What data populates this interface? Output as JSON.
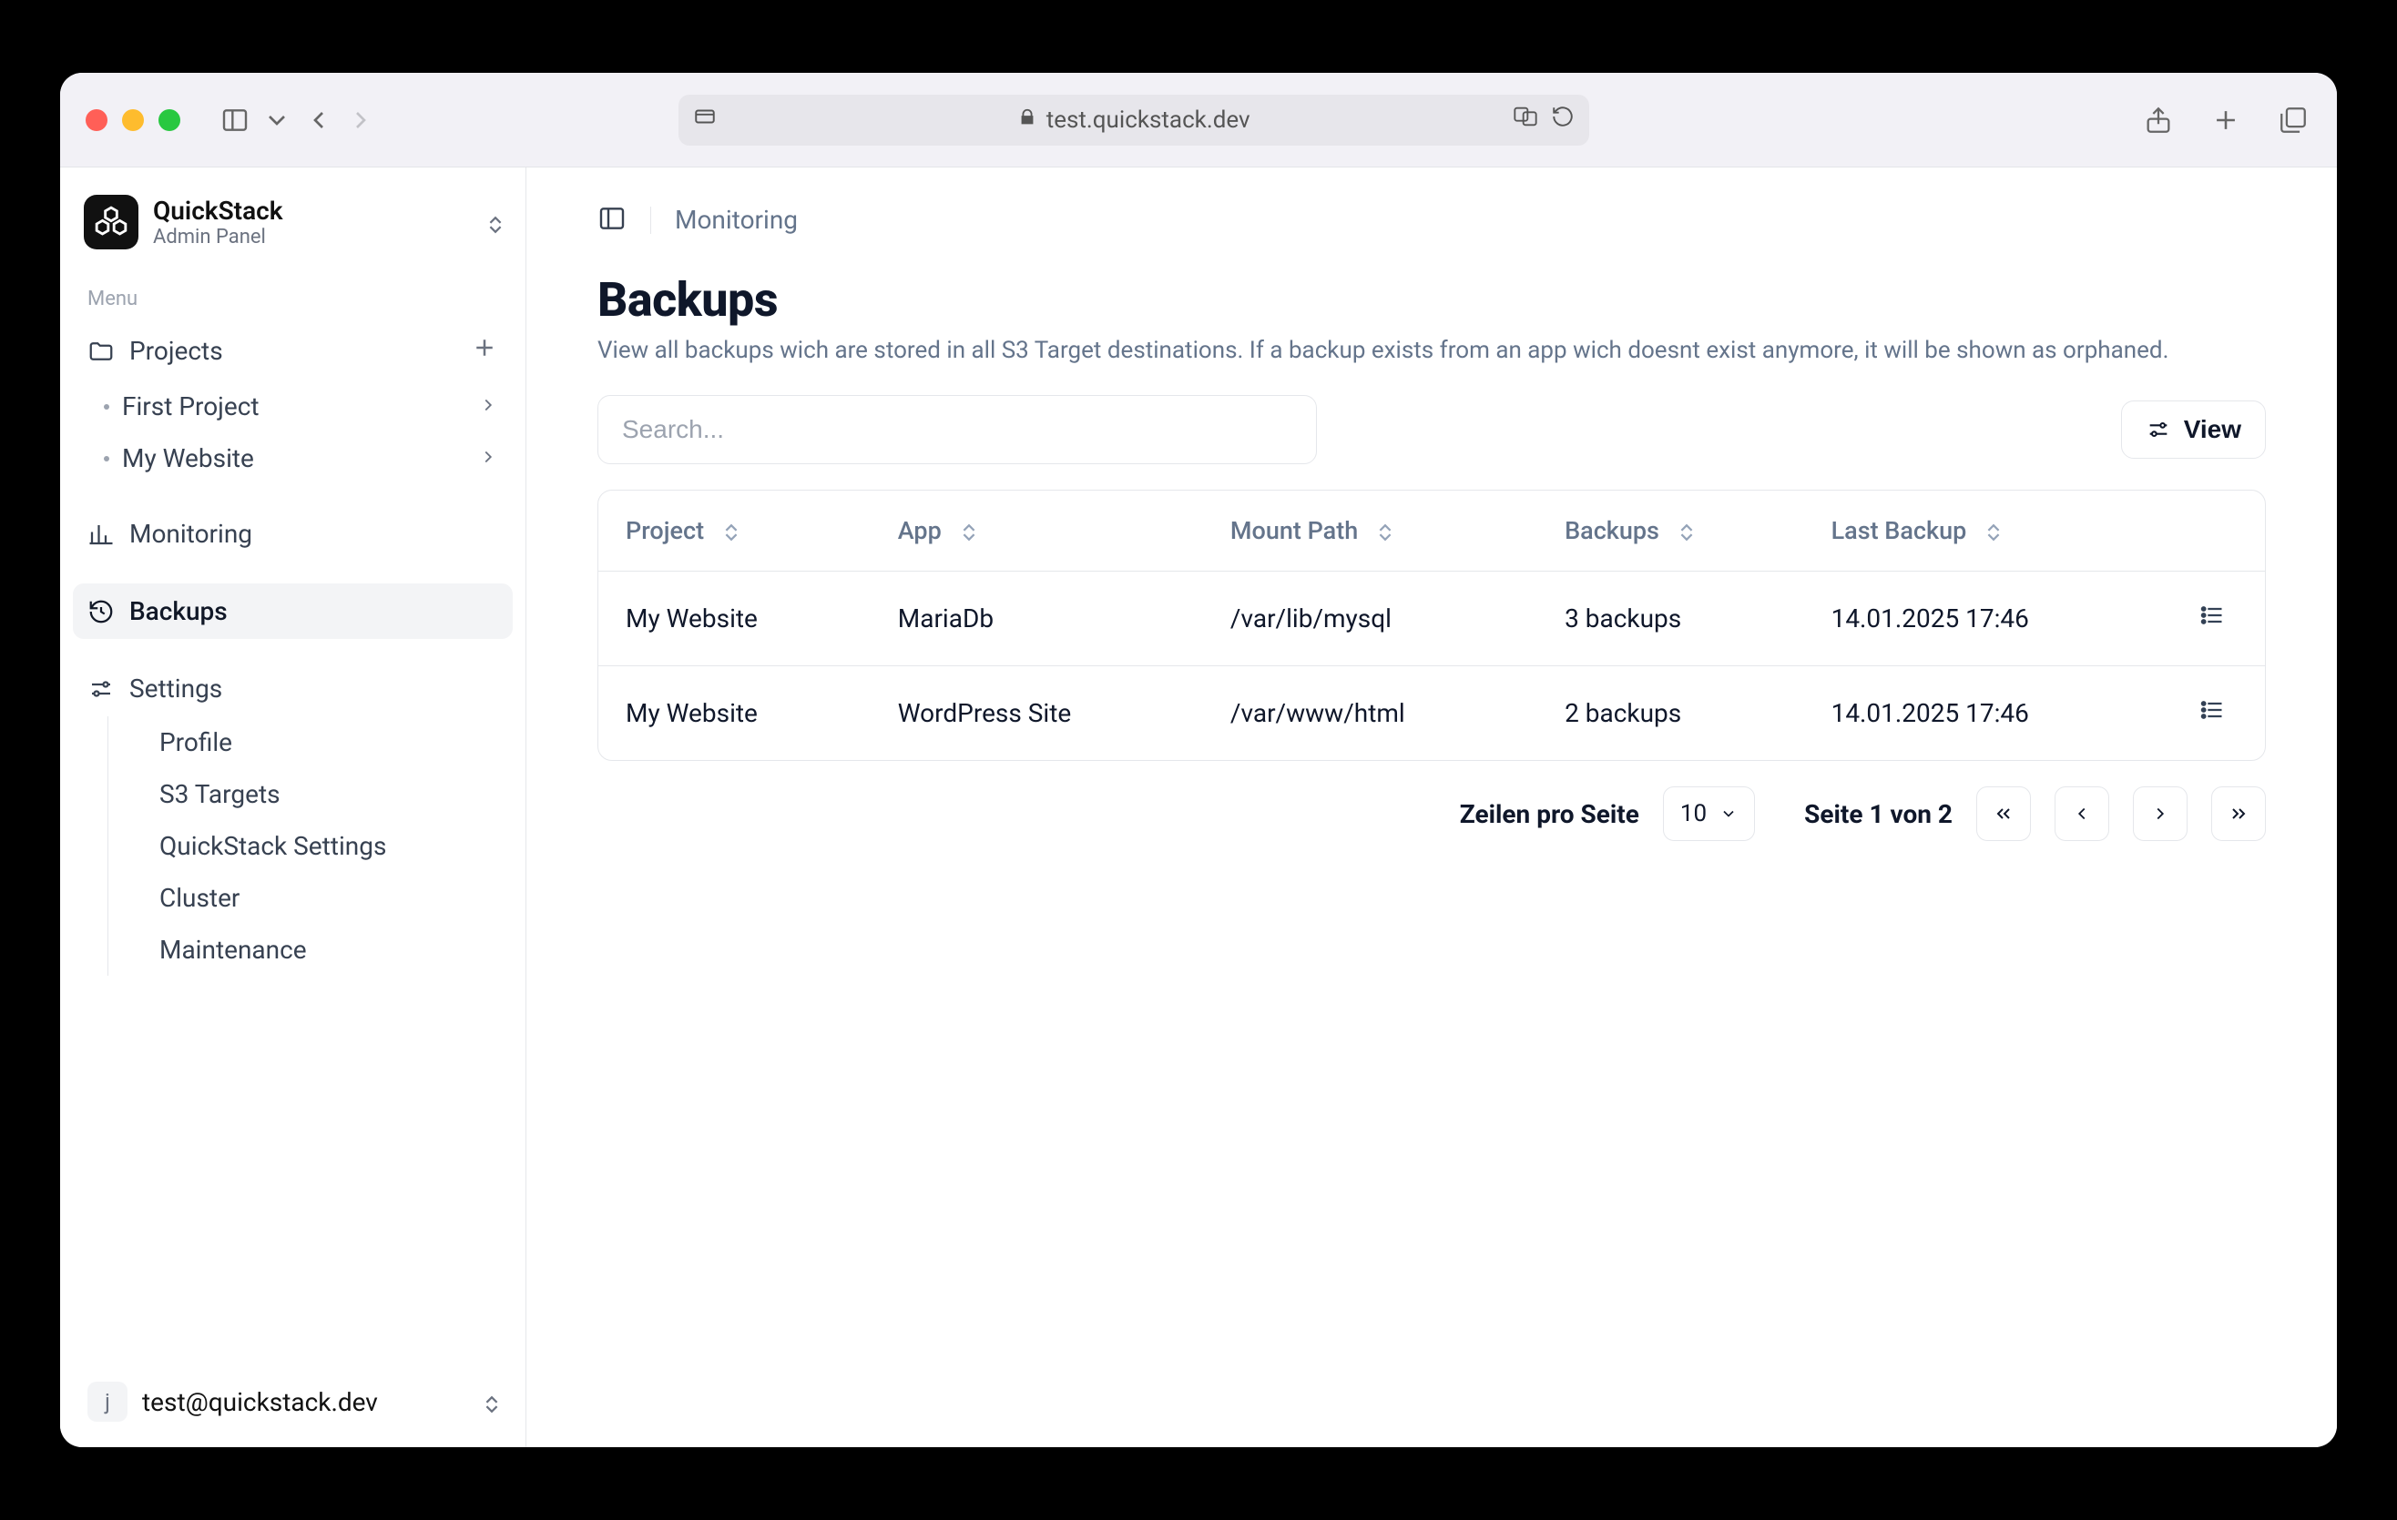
{
  "browser": {
    "address": "test.quickstack.dev"
  },
  "brand": {
    "name": "QuickStack",
    "subtitle": "Admin Panel"
  },
  "sidebar": {
    "menu_label": "Menu",
    "projects_label": "Projects",
    "projects": [
      {
        "label": "First Project"
      },
      {
        "label": "My Website"
      }
    ],
    "monitoring_label": "Monitoring",
    "backups_label": "Backups",
    "settings_label": "Settings",
    "settings_items": [
      {
        "label": "Profile"
      },
      {
        "label": "S3 Targets"
      },
      {
        "label": "QuickStack Settings"
      },
      {
        "label": "Cluster"
      },
      {
        "label": "Maintenance"
      }
    ]
  },
  "footer": {
    "avatar_letter": "j",
    "email": "test@quickstack.dev"
  },
  "breadcrumb": {
    "item": "Monitoring"
  },
  "page": {
    "title": "Backups",
    "subtitle": "View all backups wich are stored in all S3 Target destinations. If a backup exists from an app wich doesnt exist anymore, it will be shown as orphaned."
  },
  "toolbar": {
    "search_placeholder": "Search...",
    "view_label": "View"
  },
  "table": {
    "columns": {
      "project": "Project",
      "app": "App",
      "mount_path": "Mount Path",
      "backups": "Backups",
      "last_backup": "Last Backup"
    },
    "rows": [
      {
        "project": "My Website",
        "app": "MariaDb",
        "mount_path": "/var/lib/mysql",
        "backups": "3 backups",
        "last_backup": "14.01.2025 17:46"
      },
      {
        "project": "My Website",
        "app": "WordPress Site",
        "mount_path": "/var/www/html",
        "backups": "2 backups",
        "last_backup": "14.01.2025 17:46"
      }
    ]
  },
  "pagination": {
    "rows_per_page_label": "Zeilen pro Seite",
    "rows_per_page_value": "10",
    "page_info": "Seite 1 von 2"
  }
}
